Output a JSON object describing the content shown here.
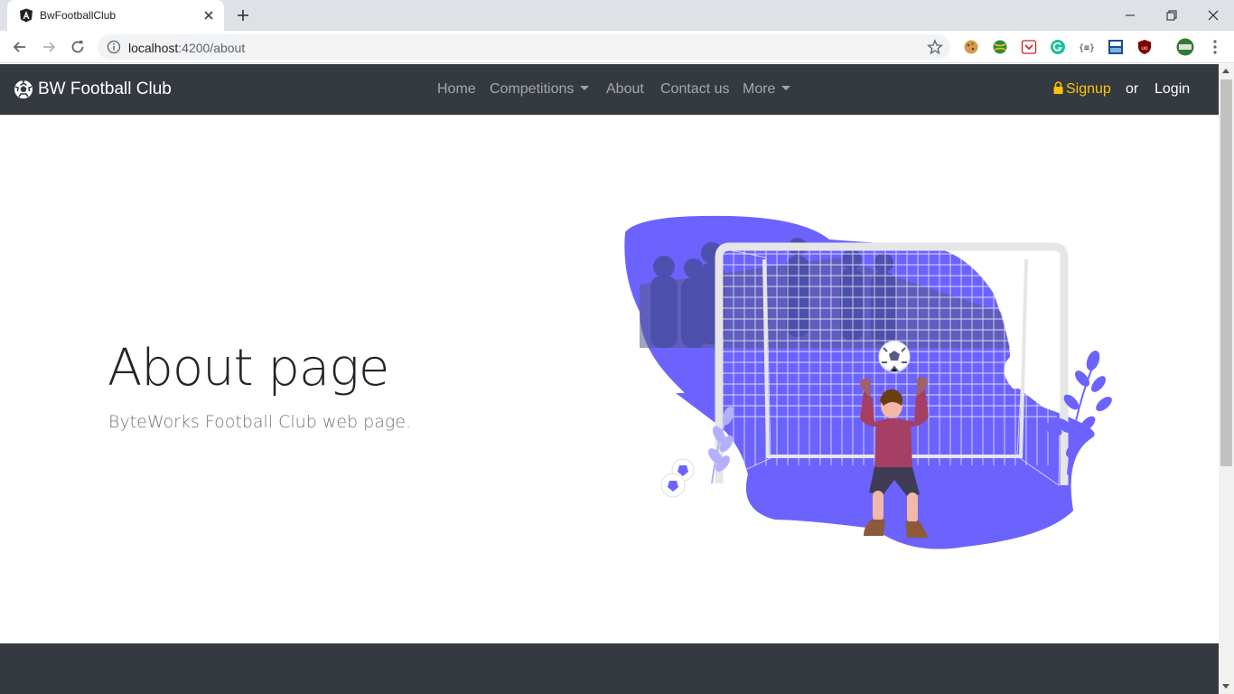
{
  "browser": {
    "tab_title": "BwFootballClub",
    "url_host": "localhost",
    "url_path": ":4200/about"
  },
  "navbar": {
    "brand": "BW Football Club",
    "links": {
      "home": "Home",
      "competitions": "Competitions",
      "about": "About",
      "contact": "Contact us",
      "more": "More"
    },
    "signup": "Signup",
    "or": "or",
    "login": "Login"
  },
  "hero": {
    "title": "About page",
    "subtitle": "ByteWorks Football Club web page."
  },
  "colors": {
    "navbar_bg": "#343a40",
    "accent_purple": "#6c63ff",
    "signup_yellow": "#ffc107"
  },
  "icons": {
    "brand": "soccer-ball-icon",
    "signup": "lock-icon",
    "illustration": "goalkeeper-illustration"
  }
}
